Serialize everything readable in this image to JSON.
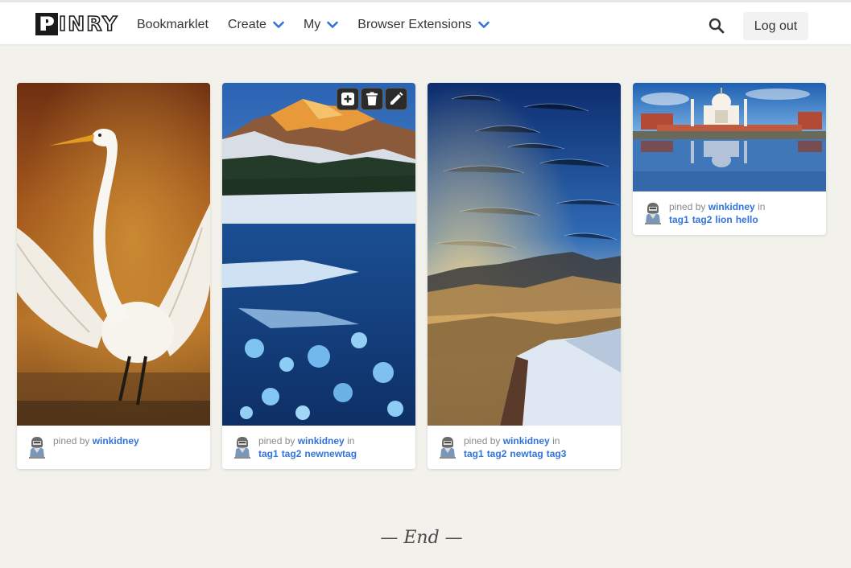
{
  "brand": {
    "logo_first": "P",
    "logo_rest": "INRY"
  },
  "nav": {
    "bookmarklet": "Bookmarklet",
    "create": "Create",
    "my": "My",
    "extensions": "Browser Extensions",
    "logout": "Log out"
  },
  "colors": {
    "accent": "#3273dc",
    "background": "#f2f1ec"
  },
  "icons": {
    "search": "search-icon",
    "add": "plus-icon",
    "delete": "trash-icon",
    "edit": "pencil-icon"
  },
  "pins": [
    {
      "by_prefix": "pined by",
      "user": "winkidney",
      "in": "",
      "tags": [],
      "image": "egret"
    },
    {
      "by_prefix": "pined by",
      "user": "winkidney",
      "in": "in",
      "tags": [
        "tag1",
        "tag2",
        "newnewtag"
      ],
      "image": "frozen-lake"
    },
    {
      "by_prefix": "pined by",
      "user": "winkidney",
      "in": "in",
      "tags": [
        "tag1",
        "tag2",
        "newtag",
        "tag3"
      ],
      "image": "star-trails"
    },
    {
      "by_prefix": "pined by",
      "user": "winkidney",
      "in": "in",
      "tags": [
        "tag1",
        "tag2",
        "lion",
        "hello"
      ],
      "image": "taj-mahal"
    }
  ],
  "footer": {
    "end": "— End —"
  }
}
